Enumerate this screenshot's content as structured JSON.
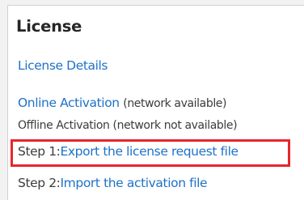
{
  "section": {
    "title": "License"
  },
  "links": {
    "license_details": "License Details",
    "online_activation": "Online Activation",
    "online_note": "(network available)",
    "offline_activation": "Offline Activation (network not available)"
  },
  "steps": [
    {
      "prefix": "Step 1:",
      "label": "Export the license request file",
      "highlighted": true
    },
    {
      "prefix": "Step 2:",
      "label": "Import the activation file",
      "highlighted": false
    }
  ],
  "colors": {
    "link": "#1e72c8",
    "highlight_border": "#e8262d",
    "text": "#3c3c3c"
  }
}
